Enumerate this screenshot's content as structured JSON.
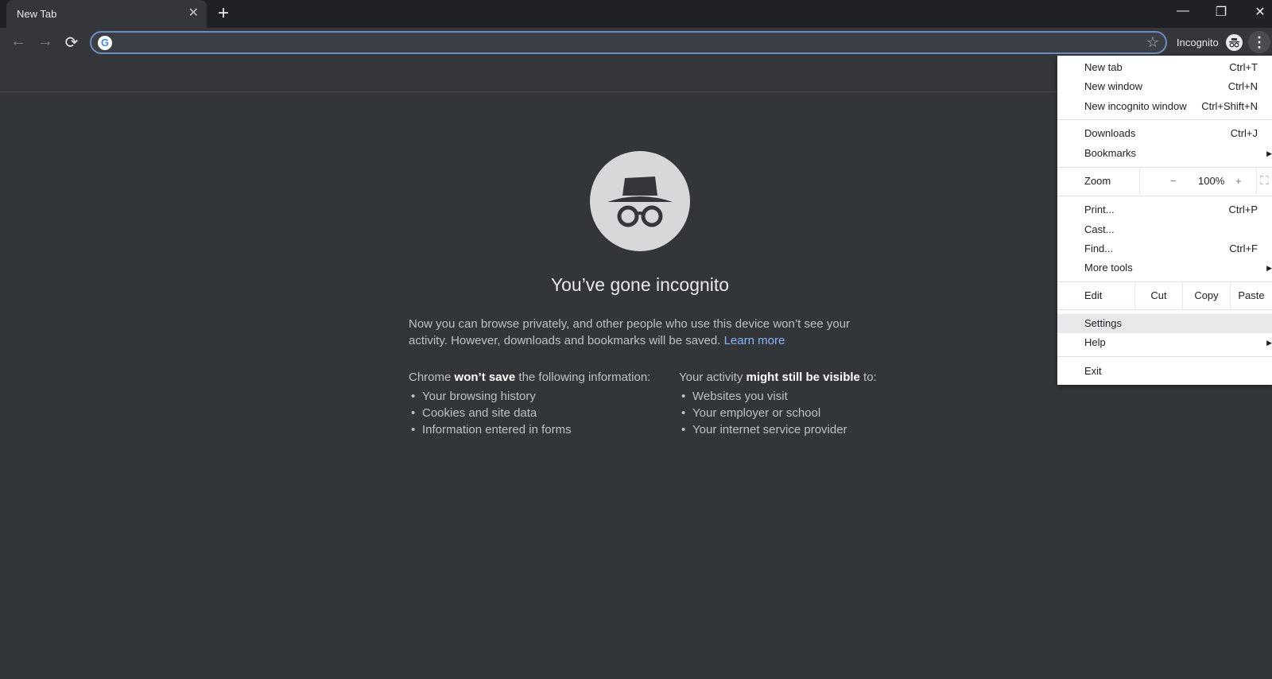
{
  "tab": {
    "title": "New Tab"
  },
  "window": {
    "minimize": "—",
    "restore": "❐",
    "close": "✕"
  },
  "toolbar": {
    "back": "←",
    "forward": "→",
    "reload": "⟳",
    "omnibox_value": "",
    "profile_label": "Incognito"
  },
  "page": {
    "title": "You’ve gone incognito",
    "intro": "Now you can browse privately, and other people who use this device won’t see your activity. However, downloads and bookmarks will be saved.",
    "learn_more": "Learn more",
    "left": {
      "pre": "Chrome ",
      "bold": "won’t save",
      "post": " the following information:",
      "items": [
        "Your browsing history",
        "Cookies and site data",
        "Information entered in forms"
      ]
    },
    "right": {
      "pre": "Your activity ",
      "bold": "might still be visible",
      "post": " to:",
      "items": [
        "Websites you visit",
        "Your employer or school",
        "Your internet service provider"
      ]
    }
  },
  "menu": {
    "new_tab": {
      "label": "New tab",
      "shortcut": "Ctrl+T"
    },
    "new_window": {
      "label": "New window",
      "shortcut": "Ctrl+N"
    },
    "new_incognito": {
      "label": "New incognito window",
      "shortcut": "Ctrl+Shift+N"
    },
    "downloads": {
      "label": "Downloads",
      "shortcut": "Ctrl+J"
    },
    "bookmarks": {
      "label": "Bookmarks"
    },
    "zoom": {
      "label": "Zoom",
      "minus": "−",
      "value": "100%",
      "plus": "+"
    },
    "print": {
      "label": "Print...",
      "shortcut": "Ctrl+P"
    },
    "cast": {
      "label": "Cast..."
    },
    "find": {
      "label": "Find...",
      "shortcut": "Ctrl+F"
    },
    "more_tools": {
      "label": "More tools"
    },
    "edit": {
      "label": "Edit",
      "cut": "Cut",
      "copy": "Copy",
      "paste": "Paste"
    },
    "settings": {
      "label": "Settings"
    },
    "help": {
      "label": "Help"
    },
    "exit": {
      "label": "Exit"
    }
  },
  "colors": {
    "highlight": "#e8e9eb",
    "link": "#8ab4f8",
    "focus_ring": "#6c8ebf"
  }
}
